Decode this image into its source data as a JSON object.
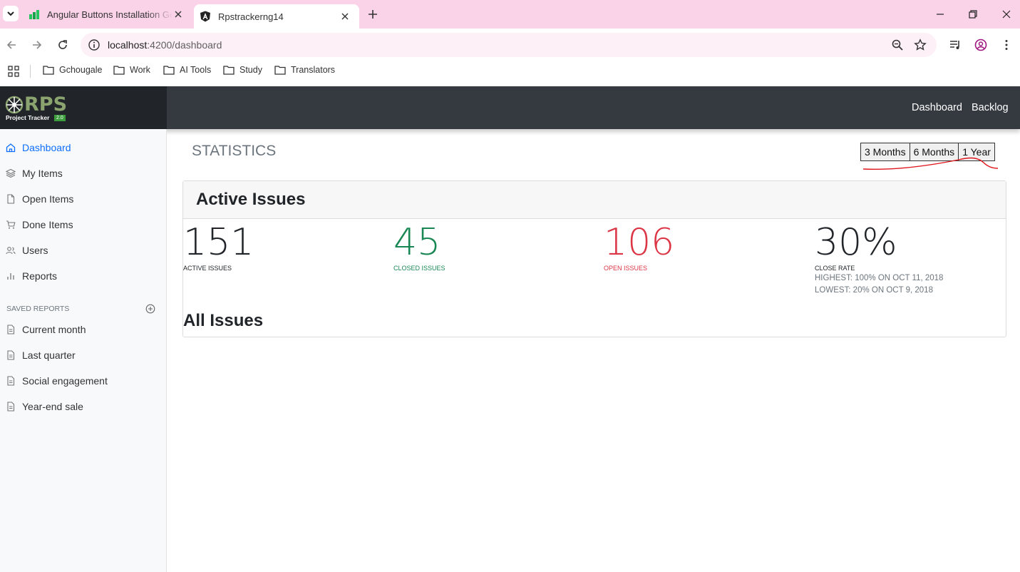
{
  "browser": {
    "tabs": [
      {
        "title": "Angular Buttons Installation Ge"
      },
      {
        "title": "Rpstrackerng14"
      }
    ],
    "url": {
      "host": "localhost",
      "path": ":4200/dashboard"
    },
    "bookmarks": [
      "Gchougale",
      "Work",
      "AI Tools",
      "Study",
      "Translators"
    ]
  },
  "header": {
    "logo_text": "RPS",
    "logo_sub": "Project Tracker",
    "logo_version": "2.0",
    "nav": [
      "Dashboard",
      "Backlog"
    ]
  },
  "sidebar": {
    "items": [
      {
        "label": "Dashboard",
        "icon": "home-icon"
      },
      {
        "label": "My Items",
        "icon": "layers-icon"
      },
      {
        "label": "Open Items",
        "icon": "file-icon"
      },
      {
        "label": "Done Items",
        "icon": "cart-icon"
      },
      {
        "label": "Users",
        "icon": "users-icon"
      },
      {
        "label": "Reports",
        "icon": "bar-chart-icon"
      }
    ],
    "saved_heading": "SAVED REPORTS",
    "saved_reports": [
      "Current month",
      "Last quarter",
      "Social engagement",
      "Year-end sale"
    ]
  },
  "main": {
    "title": "STATISTICS",
    "ranges": [
      "3 Months",
      "6 Months",
      "1 Year"
    ],
    "card_title": "Active Issues",
    "stats": [
      {
        "value": "151",
        "label": "ACTIVE ISSUES",
        "color": "#212529"
      },
      {
        "value": "45",
        "label": "CLOSED ISSUES",
        "color": "#198754"
      },
      {
        "value": "106",
        "label": "OPEN ISSUES",
        "color": "#dc3545"
      },
      {
        "value": "30%",
        "label": "CLOSE RATE",
        "color": "#212529"
      }
    ],
    "close_rate_high": "HIGHEST: 100% ON OCT 11, 2018",
    "close_rate_low": "LOWEST: 20% ON OCT 9, 2018",
    "all_issues": "All Issues"
  },
  "colors": {
    "tabstrip": "#fbd3e9",
    "header": "#343a40",
    "active_link": "#0d6efd",
    "annotation": "#e0161d"
  }
}
